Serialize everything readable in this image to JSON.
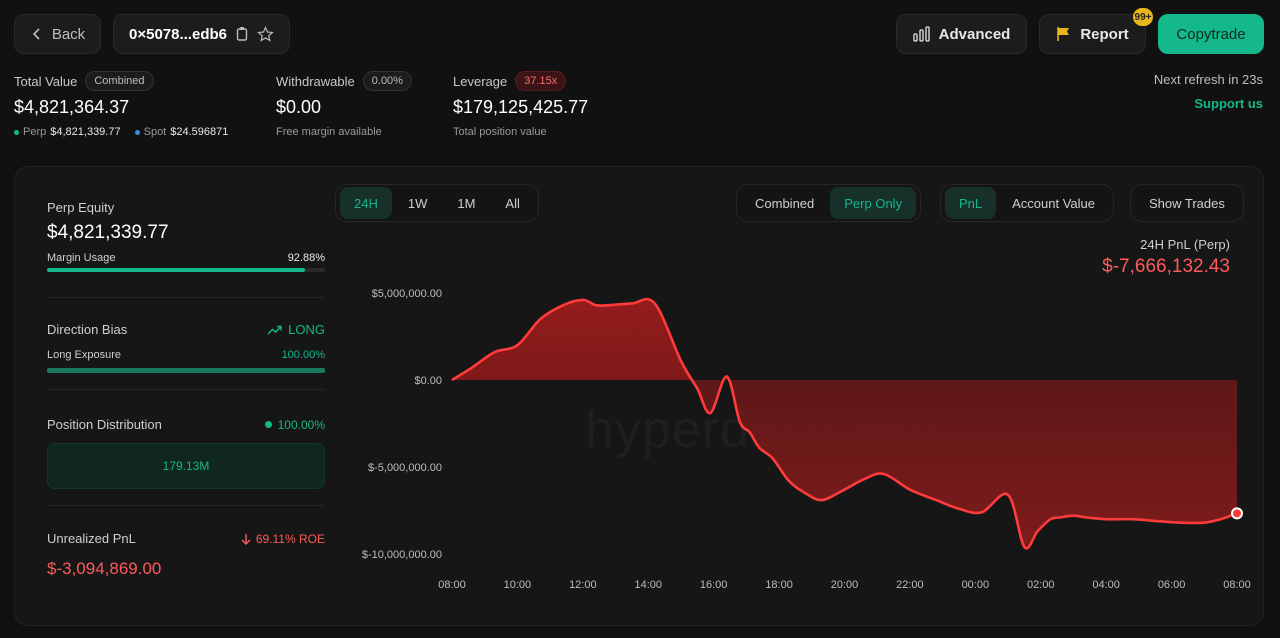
{
  "header": {
    "back_label": "Back",
    "address": "0×5078...edb6",
    "advanced_label": "Advanced",
    "report_label": "Report",
    "report_badge": "99+",
    "copytrade_label": "Copytrade"
  },
  "summary": {
    "total_value": {
      "label": "Total Value",
      "pill": "Combined",
      "value": "$4,821,364.37",
      "perp_label": "Perp",
      "perp_value": "$4,821,339.77",
      "spot_label": "Spot",
      "spot_value": "$24.596871"
    },
    "withdrawable": {
      "label": "Withdrawable",
      "pill": "0.00%",
      "value": "$0.00",
      "sub": "Free margin available"
    },
    "leverage": {
      "label": "Leverage",
      "pill": "37.15x",
      "value": "$179,125,425.77",
      "sub": "Total position value"
    },
    "refresh": "Next refresh in 23s",
    "support": "Support us"
  },
  "side": {
    "perp_equity": {
      "label": "Perp Equity",
      "value": "$4,821,339.77",
      "margin_label": "Margin Usage",
      "margin_value": "92.88%",
      "margin_fraction": 0.9288
    },
    "direction": {
      "label": "Direction Bias",
      "bias": "LONG",
      "exposure_label": "Long Exposure",
      "exposure_value": "100.00%",
      "exposure_fraction": 1.0
    },
    "distribution": {
      "label": "Position Distribution",
      "pct": "100.00%",
      "amount": "179.13M"
    },
    "unrealized": {
      "label": "Unrealized PnL",
      "roe": "69.11% ROE",
      "value": "$-3,094,869.00"
    }
  },
  "controls": {
    "ranges": [
      "24H",
      "1W",
      "1M",
      "All"
    ],
    "active_range": "24H",
    "view_modes": [
      "Combined",
      "Perp Only"
    ],
    "active_view": "Perp Only",
    "metrics": [
      "PnL",
      "Account Value"
    ],
    "active_metric": "PnL",
    "show_trades": "Show Trades"
  },
  "pnl_header": {
    "title": "24H PnL (Perp)",
    "value": "$-7,666,132.43"
  },
  "watermark": "hyperdash.info",
  "colors": {
    "accent": "#14b88a",
    "negative": "#ff3b3b",
    "report_flag": "#e7b51c"
  },
  "chart_data": {
    "type": "area",
    "title": "24H PnL (Perp)",
    "xlabel": "",
    "ylabel": "",
    "x_ticks": [
      "08:00",
      "10:00",
      "12:00",
      "14:00",
      "16:00",
      "18:00",
      "20:00",
      "22:00",
      "00:00",
      "02:00",
      "04:00",
      "06:00",
      "08:00"
    ],
    "y_ticks": [
      5000000,
      0,
      -5000000,
      -10000000
    ],
    "y_tick_labels": [
      "$5,000,000.00",
      "$0.00",
      "$-5,000,000.00",
      "$-10,000,000.00"
    ],
    "ylim": [
      -10000000,
      5000000
    ],
    "x_hours": [
      0,
      0.6,
      1.3,
      2.0,
      2.7,
      3.4,
      4.0,
      4.4,
      4.8,
      5.5,
      6.2,
      7.0,
      7.5,
      7.9,
      8.4,
      8.8,
      9.1,
      9.4,
      9.8,
      10.3,
      10.8,
      11.3,
      11.9,
      12.6,
      13.2,
      14.0,
      14.8,
      15.5,
      16.2,
      17.0,
      17.5,
      17.9,
      18.3,
      18.6,
      19.0,
      19.4,
      20.0,
      20.8,
      21.5,
      22.3,
      23.0,
      23.5,
      24.0
    ],
    "y_values": [
      0,
      700000,
      1600000,
      2000000,
      3500000,
      4300000,
      4600000,
      4300000,
      4300000,
      4400000,
      4400000,
      1100000,
      -500000,
      -1900000,
      200000,
      -2400000,
      -3000000,
      -3900000,
      -4500000,
      -5800000,
      -6500000,
      -6900000,
      -6400000,
      -5700000,
      -5400000,
      -6300000,
      -6900000,
      -7400000,
      -7600000,
      -6600000,
      -9600000,
      -8700000,
      -8000000,
      -7900000,
      -7800000,
      -7900000,
      -8000000,
      -8000000,
      -8100000,
      -8200000,
      -8200000,
      -8000000,
      -7666132.43
    ],
    "grid": false,
    "legend": "none"
  }
}
